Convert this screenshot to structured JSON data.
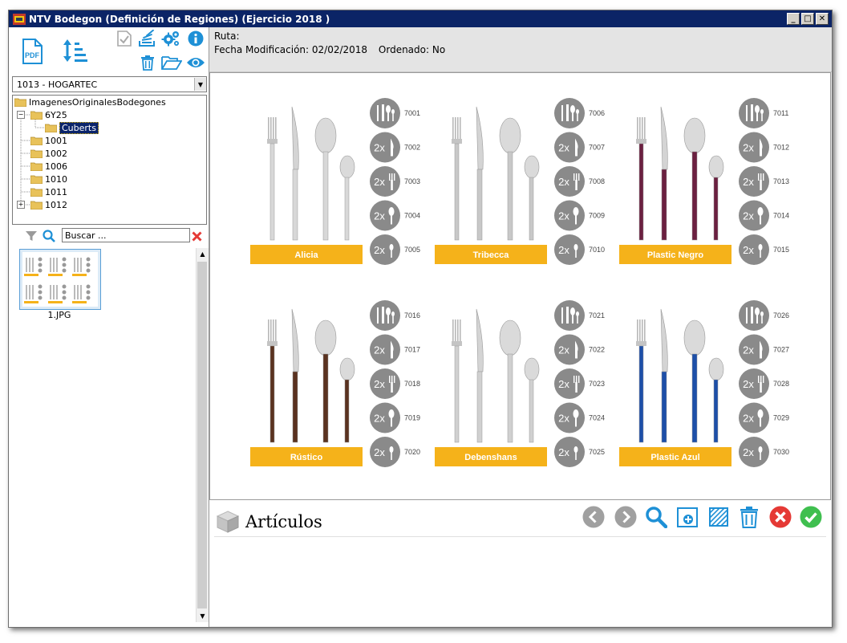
{
  "window": {
    "title": "NTV Bodegon (Definición de Regiones) (Ejercicio 2018 )"
  },
  "company_select": {
    "value": "1013 - HOGARTEC"
  },
  "tree": {
    "root": "ImagenesOriginalesBodegones",
    "child": "6Y25",
    "selected": "Cuberts",
    "others": [
      "1001",
      "1002",
      "1006",
      "1010",
      "1011",
      "1012"
    ]
  },
  "search": {
    "value": "Buscar ..."
  },
  "thumbnail": {
    "label": "1.JPG"
  },
  "info": {
    "ruta_label": "Ruta:",
    "fecha_label": "Fecha Modificación:",
    "fecha_value": "02/02/2018",
    "ordenado_label": "Ordenado:",
    "ordenado_value": "No"
  },
  "catalog": {
    "sets": [
      {
        "name": "Alicia",
        "codes": [
          "7001",
          "7002",
          "7003",
          "7004",
          "7005"
        ]
      },
      {
        "name": "Tribecca",
        "codes": [
          "7006",
          "7007",
          "7008",
          "7009",
          "7010"
        ]
      },
      {
        "name": "Plastic Negro",
        "codes": [
          "7011",
          "7012",
          "7013",
          "7014",
          "7015"
        ]
      },
      {
        "name": "Rústico",
        "codes": [
          "7016",
          "7017",
          "7018",
          "7019",
          "7020"
        ]
      },
      {
        "name": "Debenshans",
        "codes": [
          "7021",
          "7022",
          "7023",
          "7024",
          "7025"
        ]
      },
      {
        "name": "Plastic Azul",
        "codes": [
          "7026",
          "7027",
          "7028",
          "7029",
          "7030"
        ]
      }
    ],
    "badge_multiplier": "2x"
  },
  "articulos": {
    "title": "Artículos"
  },
  "colors": {
    "accent_blue": "#1e90d6",
    "banner_yellow": "#f5b21a",
    "badge_gray": "#8a8a8a",
    "cancel_red": "#e53935",
    "confirm_green": "#3fbf4f",
    "nav_gray": "#a0a0a0"
  }
}
